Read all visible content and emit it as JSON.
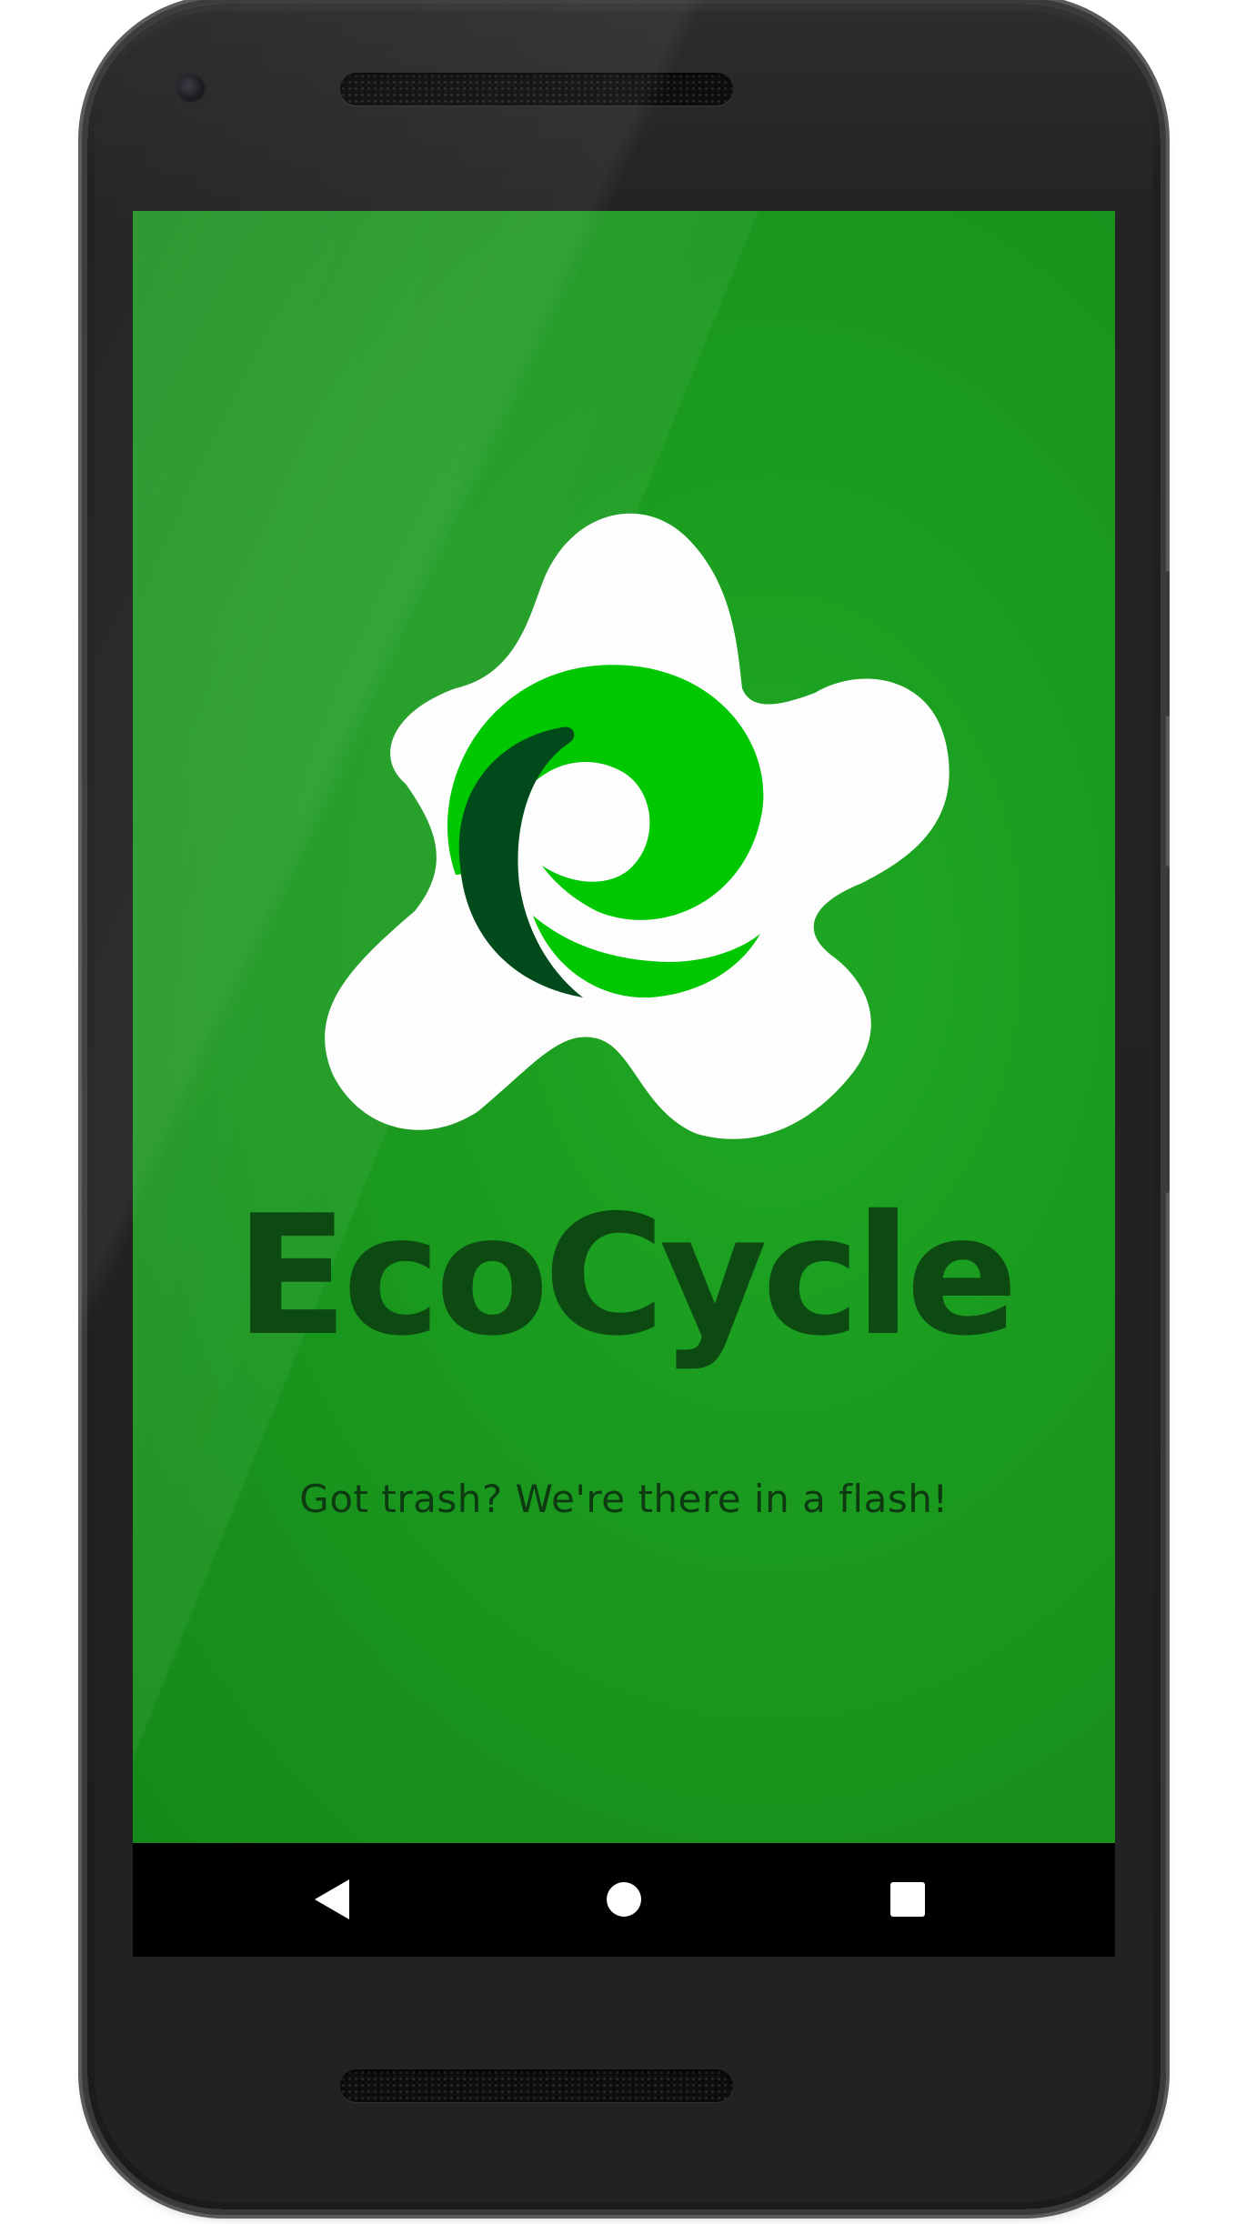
{
  "app": {
    "title": "EcoCycle",
    "tagline": "Got trash? We're there in a flash!",
    "background_color": "#1a9a1f",
    "title_color": "#0d4a12"
  },
  "logo": {
    "icon": "ecocycle-swirl-logo",
    "colors": {
      "splash": "#fdfdfd",
      "light_green": "#00c800",
      "dark_green": "#004a1c"
    }
  },
  "navbar": {
    "back_icon": "back-triangle-icon",
    "home_icon": "home-circle-icon",
    "recents_icon": "recents-square-icon"
  }
}
